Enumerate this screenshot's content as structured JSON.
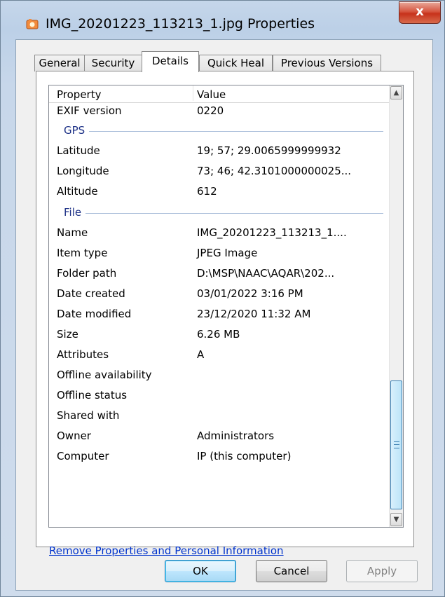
{
  "window": {
    "title": "IMG_20201223_113213_1.jpg Properties",
    "close_glyph": "x",
    "icon": "jpeg-file-icon"
  },
  "tabs": [
    {
      "label": "General"
    },
    {
      "label": "Security"
    },
    {
      "label": "Details",
      "active": true
    },
    {
      "label": "Quick Heal"
    },
    {
      "label": "Previous Versions"
    }
  ],
  "list": {
    "header": {
      "property": "Property",
      "value": "Value"
    },
    "rows_top": [
      {
        "property": "EXIF version",
        "value": "0220"
      }
    ],
    "group_gps": "GPS",
    "rows_gps": [
      {
        "property": "Latitude",
        "value": "19; 57; 29.0065999999932"
      },
      {
        "property": "Longitude",
        "value": "73; 46; 42.3101000000025..."
      },
      {
        "property": "Altitude",
        "value": "612"
      }
    ],
    "group_file": "File",
    "rows_file": [
      {
        "property": "Name",
        "value": "IMG_20201223_113213_1...."
      },
      {
        "property": "Item type",
        "value": "JPEG Image"
      },
      {
        "property": "Folder path",
        "value": "D:\\MSP\\NAAC\\AQAR\\202..."
      },
      {
        "property": "Date created",
        "value": "03/01/2022 3:16 PM"
      },
      {
        "property": "Date modified",
        "value": "23/12/2020 11:32 AM"
      },
      {
        "property": "Size",
        "value": "6.26 MB"
      },
      {
        "property": "Attributes",
        "value": "A"
      },
      {
        "property": "Offline availability",
        "value": ""
      },
      {
        "property": "Offline status",
        "value": ""
      },
      {
        "property": "Shared with",
        "value": ""
      },
      {
        "property": "Owner",
        "value": "Administrators"
      },
      {
        "property": "Computer",
        "value": "IP (this computer)"
      }
    ]
  },
  "link": "Remove Properties and Personal Information",
  "buttons": {
    "ok": "OK",
    "cancel": "Cancel",
    "apply": "Apply"
  },
  "colors": {
    "group_label": "#1e3287",
    "link": "#0033cc",
    "close": "#c7321b"
  }
}
